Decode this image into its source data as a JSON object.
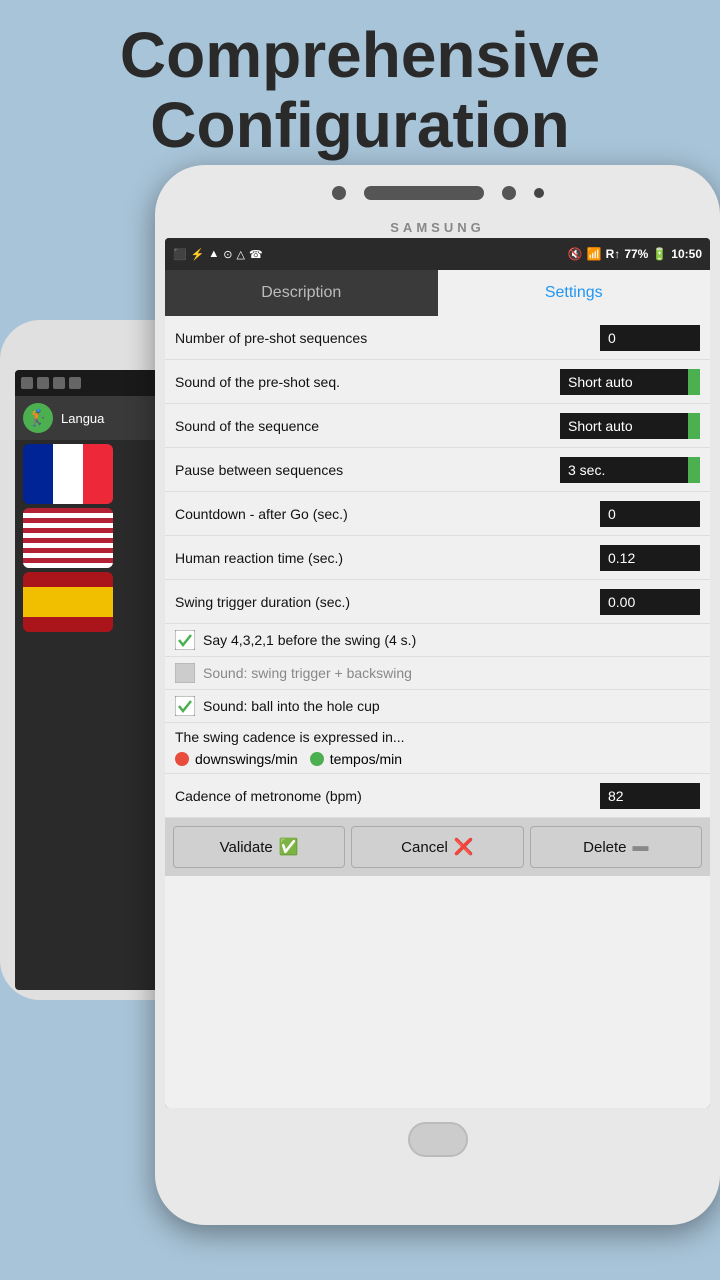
{
  "page": {
    "bg_title_line1": "Comprehensive",
    "bg_title_line2": "Configuration"
  },
  "status_bar": {
    "time": "10:50",
    "battery": "77%",
    "icons": "◻ ψ ▲ ⊙ △ ☎ 🔇 WiFi R↑↓ 77%"
  },
  "tabs": {
    "description_label": "Description",
    "settings_label": "Settings"
  },
  "settings": {
    "rows": [
      {
        "label": "Number of pre-shot sequences",
        "value": "0",
        "type": "input"
      },
      {
        "label": "Sound of the pre-shot seq.",
        "value": "Short auto",
        "type": "input-green"
      },
      {
        "label": "Sound of the sequence",
        "value": "Short auto",
        "type": "input-green"
      },
      {
        "label": "Pause between sequences",
        "value": "3 sec.",
        "type": "input-green"
      },
      {
        "label": "Countdown - after Go (sec.)",
        "value": "0",
        "type": "input"
      },
      {
        "label": "Human reaction time (sec.)",
        "value": "0.12",
        "type": "input"
      },
      {
        "label": "Swing trigger duration (sec.)",
        "value": "0.00",
        "type": "input"
      }
    ],
    "checkboxes": [
      {
        "label": "Say 4,3,2,1 before the swing (4 s.)",
        "checked": true,
        "disabled": false
      },
      {
        "label": "Sound: swing trigger + backswing",
        "checked": false,
        "disabled": true
      },
      {
        "label": "Sound: ball into the hole cup",
        "checked": true,
        "disabled": false
      }
    ],
    "cadence_title": "The swing cadence is expressed in...",
    "cadence_options": [
      {
        "label": "downswings/min",
        "color": "red"
      },
      {
        "label": "tempos/min",
        "color": "green"
      }
    ],
    "metronome_label": "Cadence of metronome (bpm)",
    "metronome_value": "82"
  },
  "buttons": {
    "validate": "Validate",
    "cancel": "Cancel",
    "delete": "Delete"
  },
  "samsung": "SAMSUNG"
}
